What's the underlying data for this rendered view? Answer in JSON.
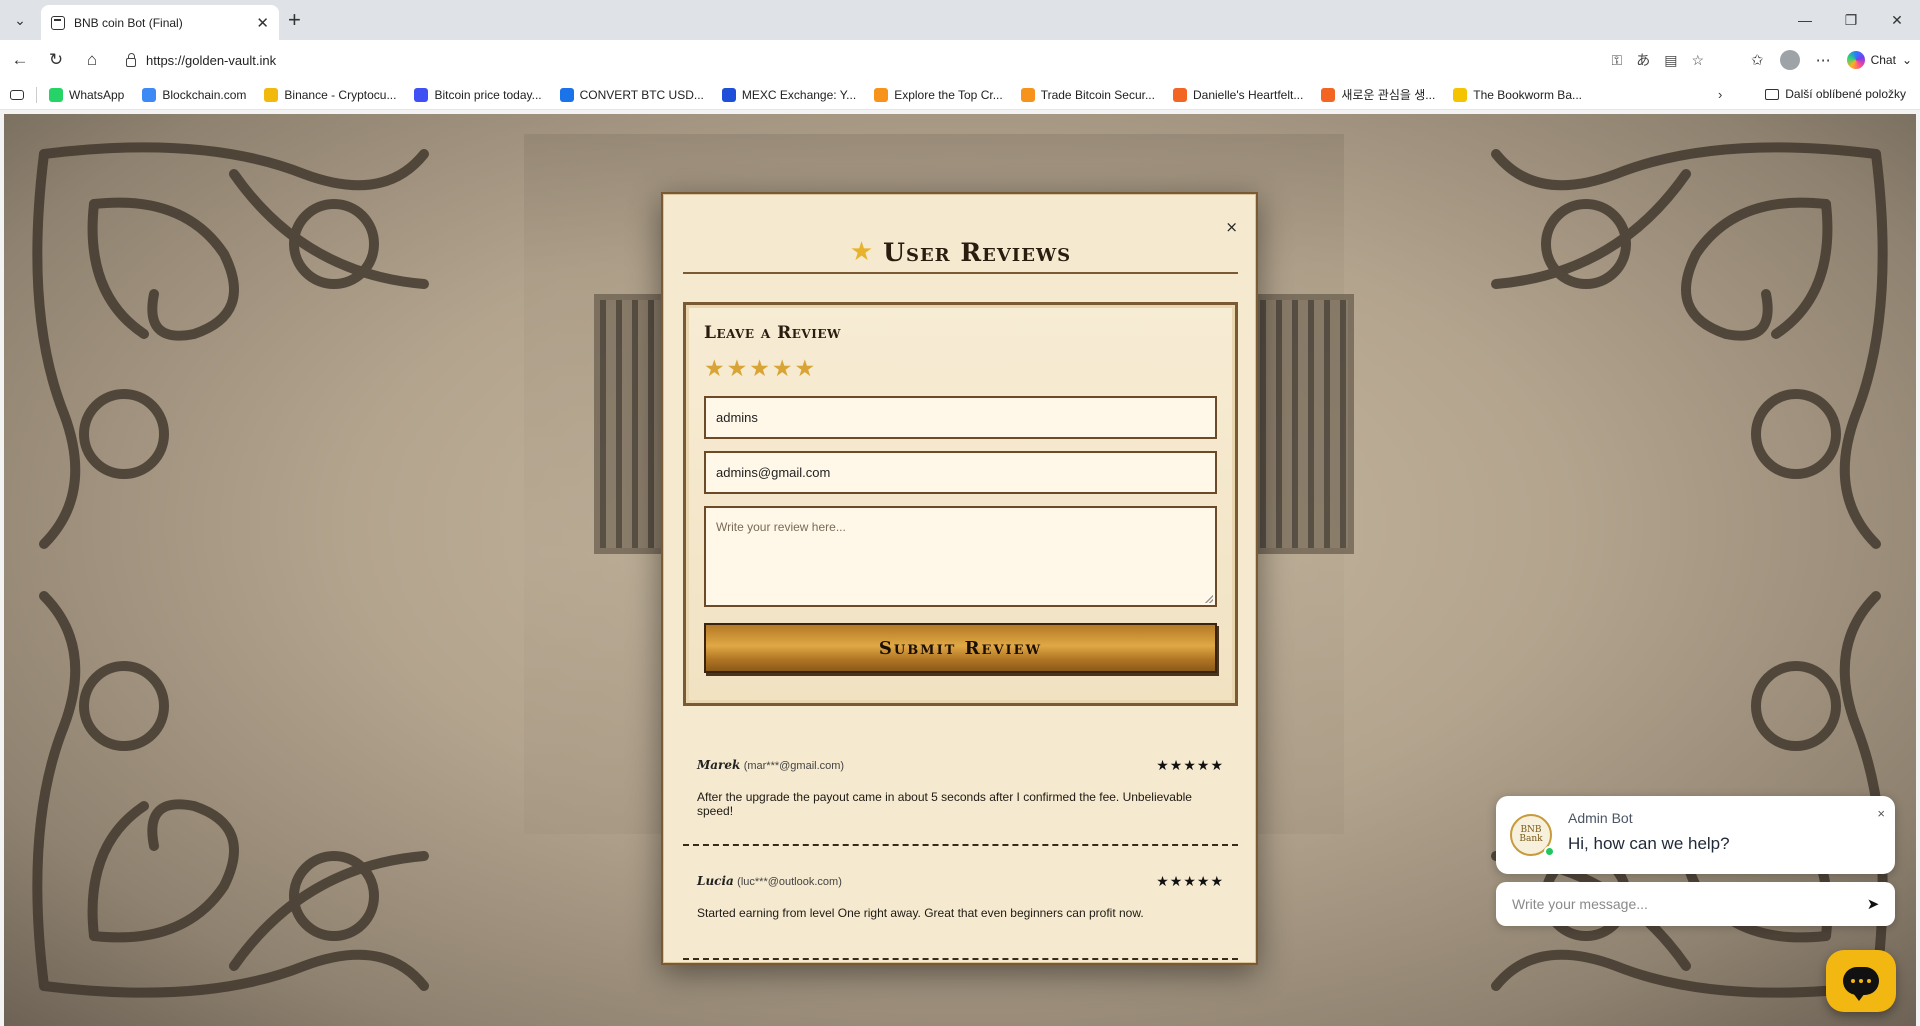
{
  "browser": {
    "tab_title": "BNB coin Bot (Final)",
    "url": "https://golden-vault.ink",
    "chat_label": "Chat",
    "bookmarks": [
      {
        "label": "WhatsApp",
        "color": "#25d366"
      },
      {
        "label": "Blockchain.com",
        "color": "#3d89f5"
      },
      {
        "label": "Binance - Cryptocu...",
        "color": "#f0b90b"
      },
      {
        "label": "Bitcoin price today...",
        "color": "#3f51f5"
      },
      {
        "label": "CONVERT BTC USD...",
        "color": "#1a73e8"
      },
      {
        "label": "MEXC Exchange: Y...",
        "color": "#1f4fd8"
      },
      {
        "label": "Explore the Top Cr...",
        "color": "#f7931a"
      },
      {
        "label": "Trade Bitcoin Secur...",
        "color": "#f7931a"
      },
      {
        "label": "Danielle's Heartfelt...",
        "color": "#f26522"
      },
      {
        "label": "새로운 관심을 생...",
        "color": "#f26522"
      },
      {
        "label": "The Bookworm Ba...",
        "color": "#f5c400"
      }
    ],
    "other_bookmarks": "Další oblíbené položky"
  },
  "modal": {
    "close": "×",
    "title": "User Reviews",
    "form": {
      "title": "Leave a Review",
      "rating": 5,
      "name_value": "admins",
      "email_value": "admins@gmail.com",
      "review_placeholder": "Write your review here...",
      "submit_label": "Submit Review"
    },
    "reviews": [
      {
        "name": "Marek",
        "email": "(mar***@gmail.com)",
        "stars": "★★★★★",
        "text": "After the upgrade the payout came in about 5 seconds after I confirmed the fee. Unbelievable speed!"
      },
      {
        "name": "Lucia",
        "email": "(luc***@outlook.com)",
        "stars": "★★★★★",
        "text": "Started earning from level One right away. Great that even beginners can profit now."
      }
    ]
  },
  "chat_widget": {
    "bot_name": "Admin Bot",
    "greeting": "Hi, how can we help?",
    "avatar_text": "BNB Bank",
    "input_placeholder": "Write your message...",
    "close": "×"
  },
  "colors": {
    "accent_gold": "#e0a845",
    "frame_brown": "#7a5a32",
    "launcher_yellow": "#f3b711"
  }
}
